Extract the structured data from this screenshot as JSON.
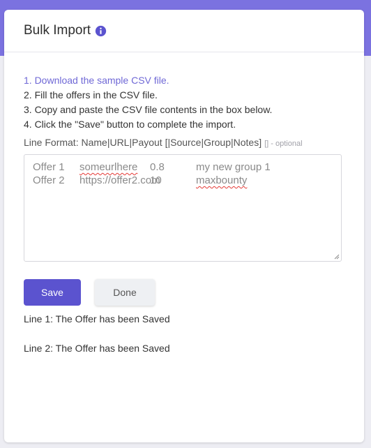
{
  "modal": {
    "title": "Bulk Import",
    "info_icon": "info-circle-icon"
  },
  "steps": [
    "1. Download the sample CSV file.",
    "2. Fill the offers in the CSV file.",
    "3. Copy and paste the CSV file contents in the box below.",
    "4. Click the \"Save\" button to complete the import."
  ],
  "line_format": {
    "label": "Line Format: Name|URL|Payout [|Source|Group|Notes]",
    "hint": "[] - optional"
  },
  "csv_rows": [
    [
      "Offer 1",
      "someurlhere",
      "0.8",
      "my new group 1"
    ],
    [
      "Offer 2",
      "https://offer2.com",
      "10",
      "maxbounty"
    ]
  ],
  "buttons": {
    "save": "Save",
    "done": "Done"
  },
  "results": [
    "Line 1: The Offer has been Saved",
    "Line 2: The Offer has been Saved"
  ],
  "colors": {
    "accent": "#5b53cf",
    "link": "#6f68d6",
    "header_band": "#7b72e0"
  }
}
